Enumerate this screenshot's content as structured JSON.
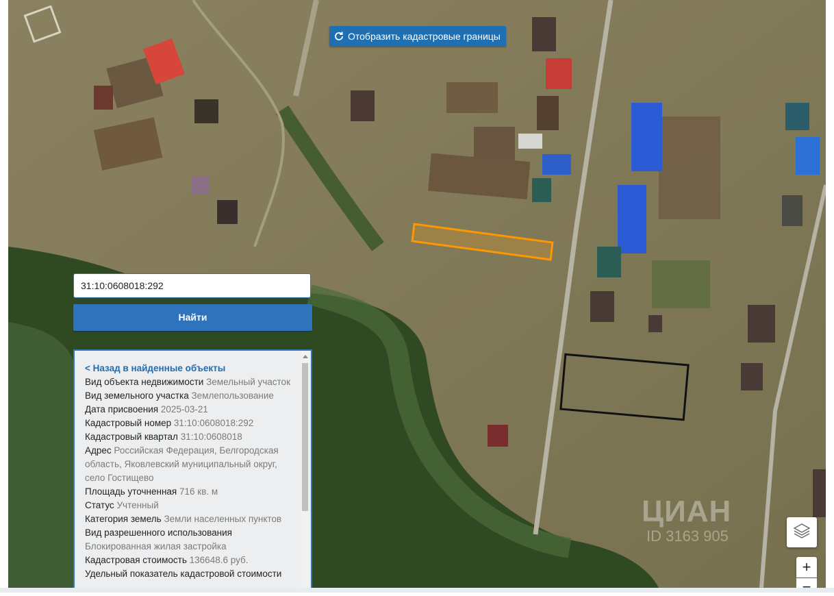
{
  "map": {
    "cadastral_button_label": "Отобразить кадастровые границы",
    "refresh_icon": "refresh-icon",
    "layers_icon": "layers-icon",
    "zoom_in_label": "+",
    "zoom_out_label": "−",
    "watermark_text": "ЦИАН",
    "watermark_id": "ID 3163 905",
    "parcel_color": "#ff9800"
  },
  "search": {
    "value": "31:10:0608018:292",
    "button_label": "Найти"
  },
  "info": {
    "back_label": "< Назад в найденные объекты",
    "rows": [
      {
        "label": "Вид объекта недвижимости",
        "value": "Земельный участок"
      },
      {
        "label": "Вид земельного участка",
        "value": "Землепользование"
      },
      {
        "label": "Дата присвоения",
        "value": "2025-03-21"
      },
      {
        "label": "Кадастровый номер",
        "value": "31:10:0608018:292"
      },
      {
        "label": "Кадастровый квартал",
        "value": "31:10:0608018"
      },
      {
        "label": "Адрес",
        "value": "Российская Федерация, Белгородская область, Яковлевский муниципальный округ, село Гостищево"
      },
      {
        "label": "Площадь уточненная",
        "value": "716 кв. м"
      },
      {
        "label": "Статус",
        "value": "Учтенный"
      },
      {
        "label": "Категория земель",
        "value": "Земли населенных пунктов"
      },
      {
        "label": "Вид разрешенного использования",
        "value": "Блокированная жилая застройка"
      },
      {
        "label": "Кадастровая стоимость",
        "value": "136648.6 руб."
      },
      {
        "label": "Удельный показатель кадастровой стоимости",
        "value": ""
      }
    ]
  }
}
